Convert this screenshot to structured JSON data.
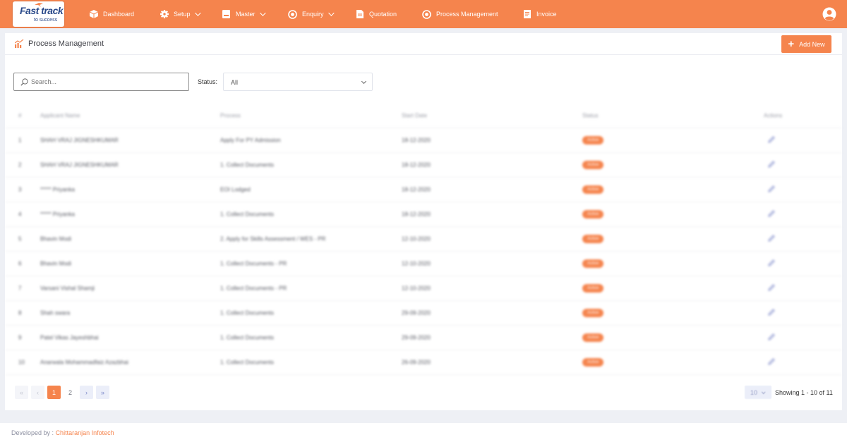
{
  "brand": {
    "logo_line1": "Fast track",
    "logo_line2": "to success"
  },
  "nav": [
    {
      "label": "Dashboard",
      "icon": "box-icon",
      "dropdown": false
    },
    {
      "label": "Setup",
      "icon": "gear-icon",
      "dropdown": true
    },
    {
      "label": "Master",
      "icon": "card-icon",
      "dropdown": true
    },
    {
      "label": "Enquiry",
      "icon": "target-icon",
      "dropdown": true
    },
    {
      "label": "Quotation",
      "icon": "document-icon",
      "dropdown": false
    },
    {
      "label": "Process Management",
      "icon": "target-icon",
      "dropdown": false
    },
    {
      "label": "Invoice",
      "icon": "invoice-icon",
      "dropdown": false
    }
  ],
  "page": {
    "title": "Process Management",
    "add_label": "Add New"
  },
  "filters": {
    "search_placeholder": "Search...",
    "status_label": "Status:",
    "status_value": "All"
  },
  "table": {
    "headers": {
      "num": "#",
      "name": "Applicant Name",
      "process": "Process",
      "date": "Start Date",
      "status": "Status",
      "actions": "Actions"
    },
    "rows": [
      {
        "num": "1",
        "name": "SHAH VRAJ JIGNESHKUMAR",
        "process": "Apply For PY Admission",
        "date": "18-12-2020",
        "status": "Active"
      },
      {
        "num": "2",
        "name": "SHAH VRAJ JIGNESHKUMAR",
        "process": "1. Collect Documents",
        "date": "18-12-2020",
        "status": "Active"
      },
      {
        "num": "3",
        "name": "***** Priyanka",
        "process": "EOI Lodged",
        "date": "18-12-2020",
        "status": "Active"
      },
      {
        "num": "4",
        "name": "***** Priyanka",
        "process": "1. Collect Documents",
        "date": "18-12-2020",
        "status": "Active"
      },
      {
        "num": "5",
        "name": "Bhavin Modi",
        "process": "2. Apply for Skills Assessment / WES - PR",
        "date": "12-10-2020",
        "status": "Active"
      },
      {
        "num": "6",
        "name": "Bhavin Modi",
        "process": "1. Collect Documents - PR",
        "date": "12-10-2020",
        "status": "Active"
      },
      {
        "num": "7",
        "name": "Varsani Vishal Shamji",
        "process": "1. Collect Documents - PR",
        "date": "12-10-2020",
        "status": "Active"
      },
      {
        "num": "8",
        "name": "Shah swara",
        "process": "1. Collect Documents",
        "date": "29-09-2020",
        "status": "Active"
      },
      {
        "num": "9",
        "name": "Patel Vikas Jayeshbhai",
        "process": "1. Collect Documents",
        "date": "29-09-2020",
        "status": "Active"
      },
      {
        "num": "10",
        "name": "Anarwala Mohammadfaiz Azazbhai",
        "process": "1. Collect Documents",
        "date": "26-09-2020",
        "status": "Active"
      }
    ]
  },
  "pagination": {
    "first": "«",
    "prev": "‹",
    "pages": [
      "1",
      "2"
    ],
    "active_page": "1",
    "next": "›",
    "last": "»",
    "per_page": "10",
    "showing": "Showing 1 - 10 of 11"
  },
  "footer": {
    "developed_by": "Developed by :",
    "company": "Chittaranjan Infotech"
  },
  "colors": {
    "accent": "#f5844d",
    "nav_text": "#ffffff",
    "page_bg": "#eef0f5"
  }
}
